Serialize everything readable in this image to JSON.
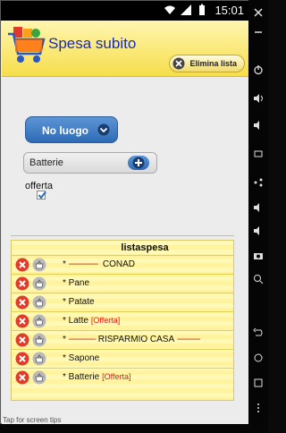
{
  "status_bar": {
    "time": "15:01"
  },
  "header": {
    "title": "Spesa subito",
    "clear_list_label": "Elimina lista"
  },
  "form": {
    "place_button_label": "No luogo",
    "item_value": "Batterie",
    "offer_label": "offerta",
    "offer_checked": true
  },
  "list": {
    "header": "listaspesa",
    "rows": [
      {
        "type": "shop",
        "text": "CONAD"
      },
      {
        "type": "item",
        "text": "* Pane",
        "offer": ""
      },
      {
        "type": "item",
        "text": "* Patate",
        "offer": ""
      },
      {
        "type": "item",
        "text": "* Latte",
        "offer": "[Offerta]"
      },
      {
        "type": "shop",
        "text": "RISPARMIO CASA"
      },
      {
        "type": "item",
        "text": "* Sapone",
        "offer": ""
      },
      {
        "type": "item",
        "text": "* Batterie",
        "offer": "[Offerta]"
      }
    ]
  },
  "footer_hint": "Tap for screen tips",
  "colors": {
    "accent_blue": "#2f6bb5",
    "header_yellow": "#f6de4a",
    "offer_red": "#e0181c"
  }
}
